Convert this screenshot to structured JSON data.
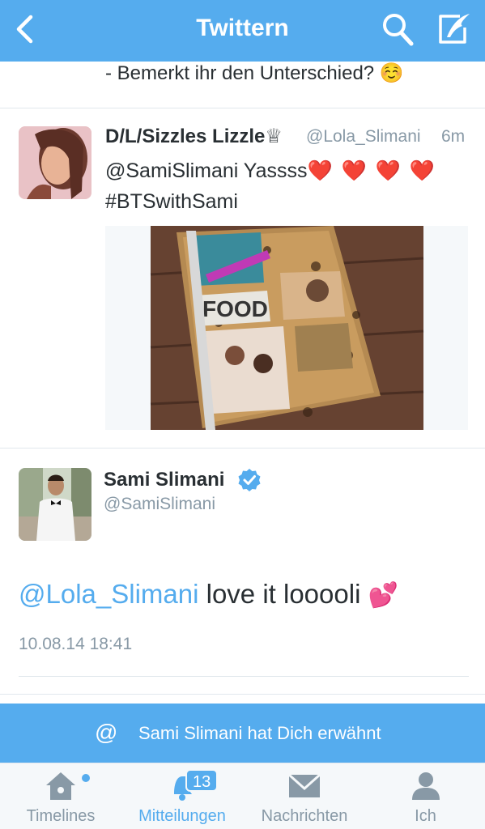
{
  "header": {
    "title": "Twittern"
  },
  "previous_tweet": {
    "text": "- Bemerkt ihr den Unterschied? ☺️"
  },
  "tweet1": {
    "name": "D/L/Sizzles Lizzle♕",
    "handle": "@Lola_Slimani",
    "time": "6m",
    "line1": "@SamiSlimani Yassss",
    "hearts": "❤️ ❤️ ❤️ ❤️",
    "line2": "#BTSwithSami"
  },
  "tweet2": {
    "name": "Sami Slimani",
    "handle": "@SamiSlimani",
    "mention": "@Lola_Slimani",
    "text": " love it looooli ",
    "emoji": "💕",
    "timestamp": "10.08.14 18:41"
  },
  "banner": {
    "at_symbol": "@",
    "message": "Sami Slimani hat Dich erwähnt"
  },
  "tabbar": {
    "tabs": [
      {
        "label": "Timelines",
        "icon": "home-icon"
      },
      {
        "label": "Mitteilungen",
        "icon": "bell-icon",
        "badge": "13"
      },
      {
        "label": "Nachrichten",
        "icon": "envelope-icon"
      },
      {
        "label": "Ich",
        "icon": "person-icon"
      }
    ]
  },
  "colors": {
    "accent": "#55acee",
    "text": "#292f33",
    "muted": "#8899a6",
    "divider": "#e1e8ed"
  }
}
